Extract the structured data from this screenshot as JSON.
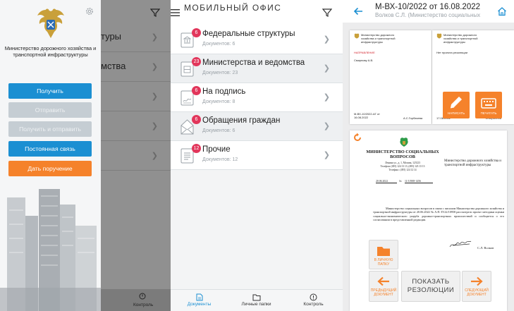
{
  "side_menu": {
    "ministry_name": "Министерство дорожного хозяйства и транспортной инфраструктуры",
    "buttons": [
      {
        "label": "Получить",
        "state": "active"
      },
      {
        "label": "Отправить",
        "state": "disabled"
      },
      {
        "label": "Получить и отправить",
        "state": "disabled"
      },
      {
        "label": "Постоянная связь",
        "state": "active"
      },
      {
        "label": "Дать поручение",
        "state": "highlight"
      }
    ],
    "background_rows": [
      "туры",
      "мства",
      "",
      "",
      ""
    ],
    "background_tab": "Контроль"
  },
  "list_screen": {
    "title": "Мобильный офис",
    "categories": [
      {
        "title": "Федеральные структуры",
        "subtitle": "Документов: 6",
        "badge": "6",
        "icon": "building-icon"
      },
      {
        "title": "Министерства и ведомства",
        "subtitle": "Документов: 23",
        "badge": "23",
        "icon": "ministry-icon"
      },
      {
        "title": "На подпись",
        "subtitle": "Документов: 8",
        "badge": "6",
        "icon": "signature-icon"
      },
      {
        "title": "Обращения граждан",
        "subtitle": "Документов: 6",
        "badge": "6",
        "icon": "envelope-icon"
      },
      {
        "title": "Прочие",
        "subtitle": "Документов: 12",
        "badge": "12",
        "icon": "document-icon"
      }
    ],
    "tabs": [
      {
        "label": "Документы",
        "active": true
      },
      {
        "label": "Личные папки",
        "active": false
      },
      {
        "label": "Контроль",
        "active": false
      }
    ]
  },
  "document_screen": {
    "title": "М-ВХ-10/2022 от 16.08.2022",
    "subtitle": "Волков С.Л. (Министерство социальных",
    "thumb1": {
      "section": "НАПРАВЛЕНИЕ",
      "recipient": "Смирнову А.В.",
      "number": "М-ВХ-10/2022-АГ от 16.08.2022",
      "signer": "А.С.Горбачева"
    },
    "thumb2": {
      "text": "Нет проекта резолюции",
      "number": "17.08.2022",
      "signer": "А.Кириллов"
    },
    "write_btn": "НАПИСАТЬ",
    "print_btn": "ПЕЧАТАТЬ",
    "letter": {
      "org": "МИНИСТЕРСТВО СОЦИАЛЬНЫХ ВОПРОСОВ",
      "addr": "Ленина ул., д. 1, Москва, 123123",
      "phones": "Телефон: (495) 124 13 13, (495) 123 13 13",
      "fax": "Телефакс: (495) 124 12 14",
      "date": "20.06.2022",
      "num_prefix": "№",
      "number": "11/11908-1456",
      "recipient": "Министерство дорожного хозяйства и транспортной инфраструктуры",
      "body": "Министерство социальных вопросов в связи с письмом Министерства дорожного хозяйства и транспортной инфраструктуры от 20.06.2022 № А.П.-П-22/10958 рассмотрело проект методики оценки социально-экономического ущерба дорожно-транспортных происшествий и сообщается о его согласовании в представленной редакции.",
      "signer": "С.Л. Волков"
    },
    "buttons": {
      "personal_folder": "В ЛИЧНУЮ ПАПКУ",
      "prev": "ПРЕДЫДУЩИЙ ДОКУМЕНТ",
      "show": "ПОКАЗАТЬ РЕЗОЛЮЦИИ",
      "next": "СЛЕДУЮЩИЙ ДОКУМЕНТ"
    }
  },
  "colors": {
    "blue": "#1b8fd2",
    "orange": "#f5822b",
    "badge": "#e2365b"
  }
}
